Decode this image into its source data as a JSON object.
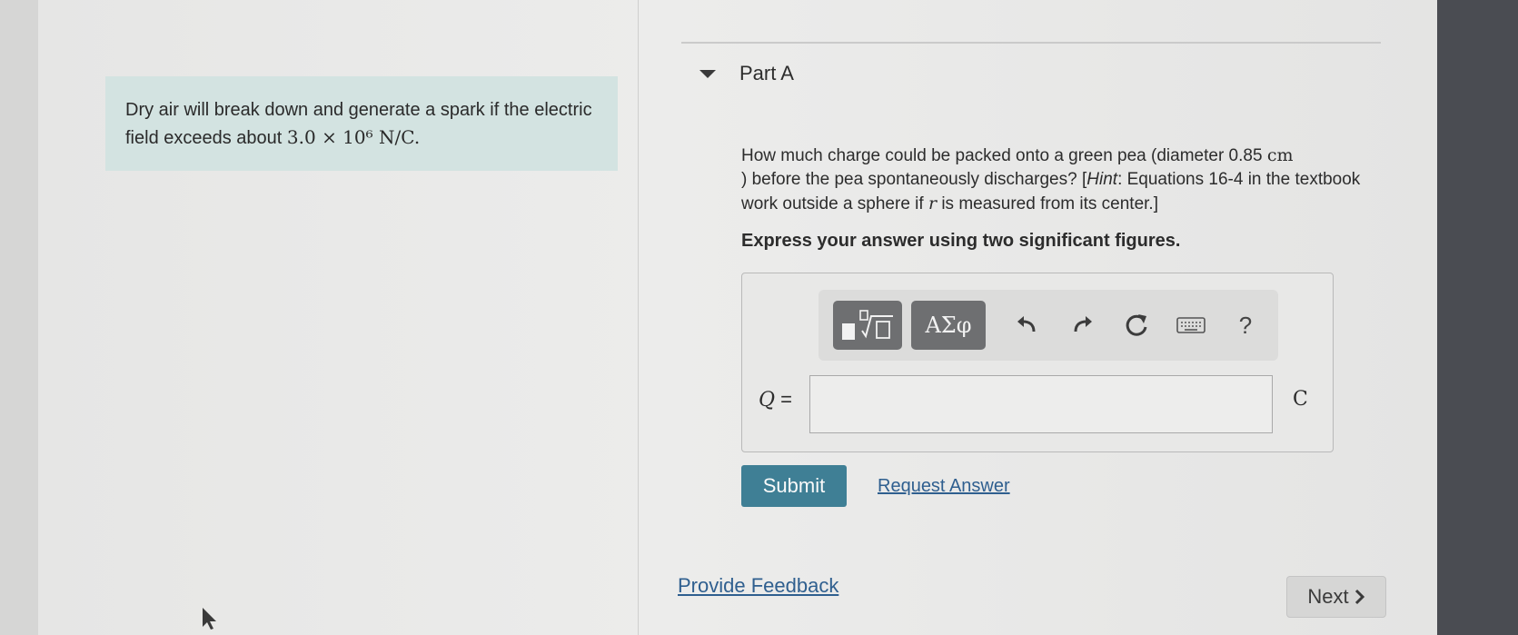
{
  "intro": {
    "text": "Dry air will break down and generate a spark if the electric field exceeds about ",
    "math": "3.0 × 10⁶ N/C."
  },
  "part": {
    "title": "Part A"
  },
  "question": {
    "text1": "How much charge could be packed onto a green pea (diameter 0.85 ",
    "unit_cm": "cm",
    "text2": ") before the pea spontaneously discharges? [",
    "hint_label": "Hint",
    "text3": ": Equations 16-4 in the textbook work outside a sphere if ",
    "var_r": "r",
    "text4": " is measured from its center.]"
  },
  "instruction": "Express your answer using two significant figures.",
  "toolbar": {
    "greek_label": "ΑΣφ",
    "help_label": "?",
    "icons": [
      "templates-icon",
      "undo-icon",
      "redo-icon",
      "reset-icon",
      "keyboard-icon",
      "help-icon"
    ]
  },
  "answer": {
    "label_var": "Q",
    "label_eq": " =",
    "value": "",
    "unit": "C"
  },
  "actions": {
    "submit_label": "Submit",
    "request_label": "Request Answer",
    "feedback_label": "Provide Feedback",
    "next_label": "Next"
  },
  "colors": {
    "intro_bg": "#d3e3e1",
    "submit_bg": "#3f7f95",
    "link": "#2f5f8f",
    "toolbar_button": "#6e6f71"
  }
}
